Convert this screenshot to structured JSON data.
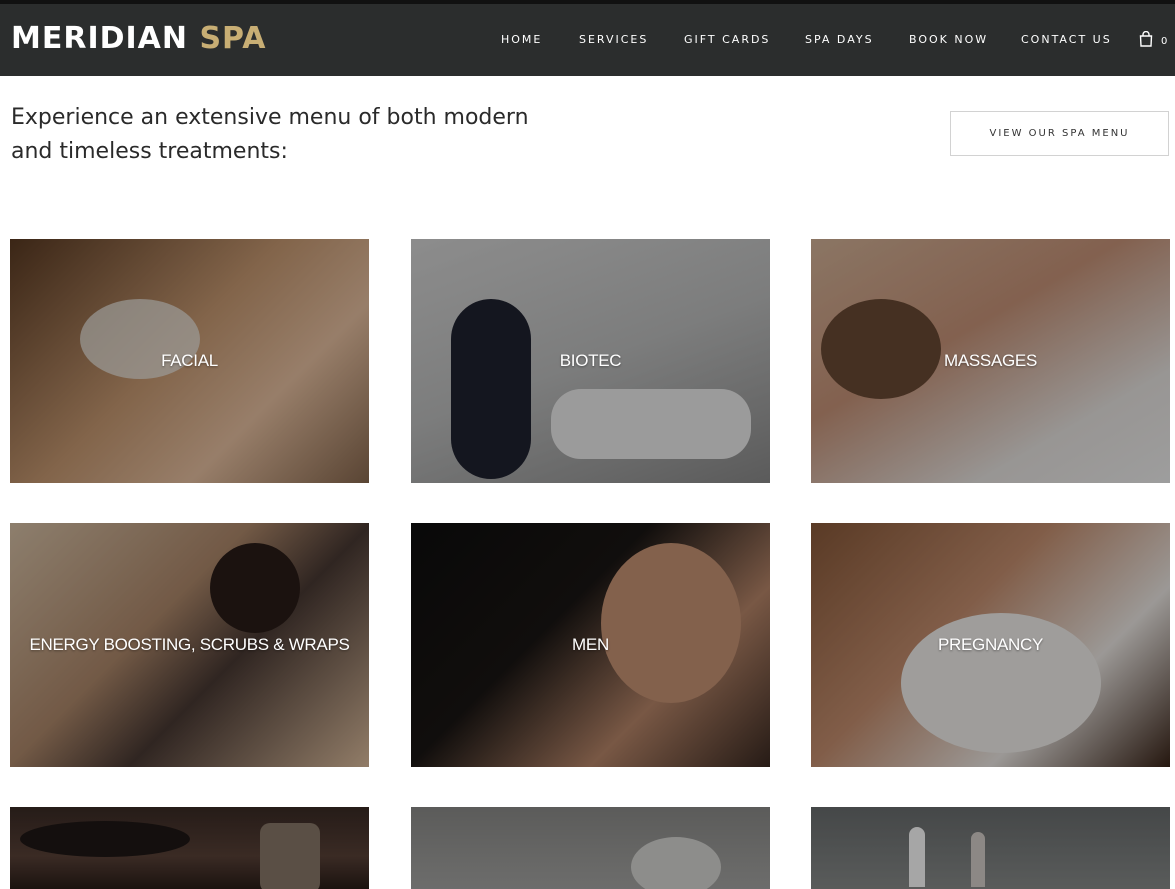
{
  "brand": {
    "logo_white": "MERIDIAN",
    "logo_gold": "SPA",
    "gold_color": "#c8ae74"
  },
  "nav": {
    "items": [
      "HOME",
      "SERVICES",
      "GIFT CARDS",
      "SPA DAYS",
      "BOOK NOW",
      "CONTACT US"
    ],
    "cart_count": "0"
  },
  "intro": {
    "text": "Experience an extensive menu of both modern and timeless treatments:",
    "button_label": "VIEW OUR SPA MENU"
  },
  "treatments": [
    {
      "label": "FACIAL",
      "image": "facial-photo"
    },
    {
      "label": "BIOTEC",
      "image": "biotec-photo"
    },
    {
      "label": "MASSAGES",
      "image": "massages-photo"
    },
    {
      "label": "ENERGY BOOSTING, SCRUBS & WRAPS",
      "image": "scrubs-wraps-photo"
    },
    {
      "label": "MEN",
      "image": "men-photo"
    },
    {
      "label": "PREGNANCY",
      "image": "pregnancy-photo"
    },
    {
      "label": "",
      "image": "hot-stones-photo"
    },
    {
      "label": "",
      "image": "tea-photo"
    },
    {
      "label": "",
      "image": "treatment-room-photo"
    }
  ]
}
